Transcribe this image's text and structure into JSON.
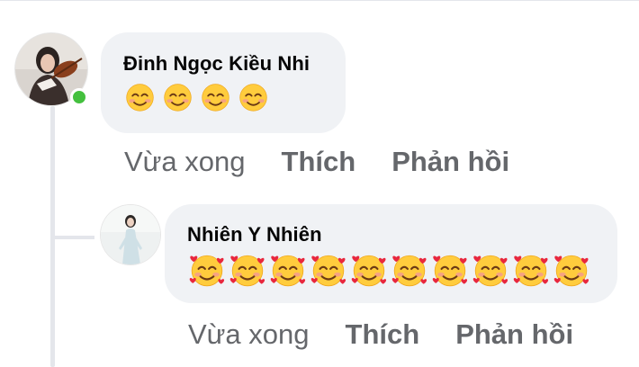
{
  "comments": [
    {
      "author": "Đinh Ngọc Kiều Nhi",
      "online": true,
      "reactions": [
        "smiling-face-with-smiling-eyes",
        "smiling-face-with-smiling-eyes",
        "smiling-face-with-smiling-eyes",
        "smiling-face-with-smiling-eyes"
      ],
      "time": "Vừa xong",
      "like_label": "Thích",
      "reply_label": "Phản hồi"
    },
    {
      "author": "Nhiên Y Nhiên",
      "online": false,
      "reactions": [
        "smiling-face-with-hearts",
        "smiling-face-with-hearts",
        "smiling-face-with-hearts",
        "smiling-face-with-hearts",
        "smiling-face-with-hearts",
        "smiling-face-with-hearts",
        "smiling-face-with-hearts",
        "smiling-face-with-hearts",
        "smiling-face-with-hearts",
        "smiling-face-with-hearts"
      ],
      "time": "Vừa xong",
      "like_label": "Thích",
      "reply_label": "Phản hồi"
    }
  ],
  "colors": {
    "bubble_bg": "#f0f2f5",
    "secondary_text": "#65676b",
    "primary_text": "#050505",
    "online_dot": "#44c03e",
    "thread_line": "#e4e6eb"
  }
}
